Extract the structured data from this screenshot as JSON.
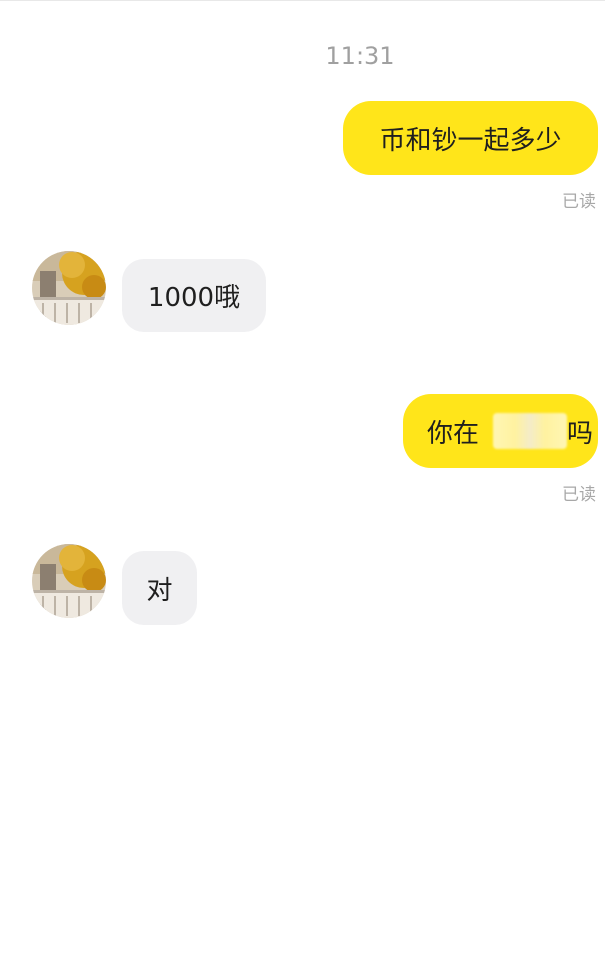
{
  "timestamp": "11:31",
  "messages": [
    {
      "direction": "out",
      "text": "币和钞一起多少",
      "status": "已读"
    },
    {
      "direction": "in",
      "text": "1000哦"
    },
    {
      "direction": "out",
      "text": "你在",
      "trailing_fragment": "吗",
      "status": "已读"
    },
    {
      "direction": "in",
      "text": "对"
    }
  ],
  "colors": {
    "outgoing_bubble": "#ffe51a",
    "incoming_bubble": "#f0f0f2",
    "timestamp": "#a0a0a0",
    "read_status": "#a8a8a8"
  }
}
